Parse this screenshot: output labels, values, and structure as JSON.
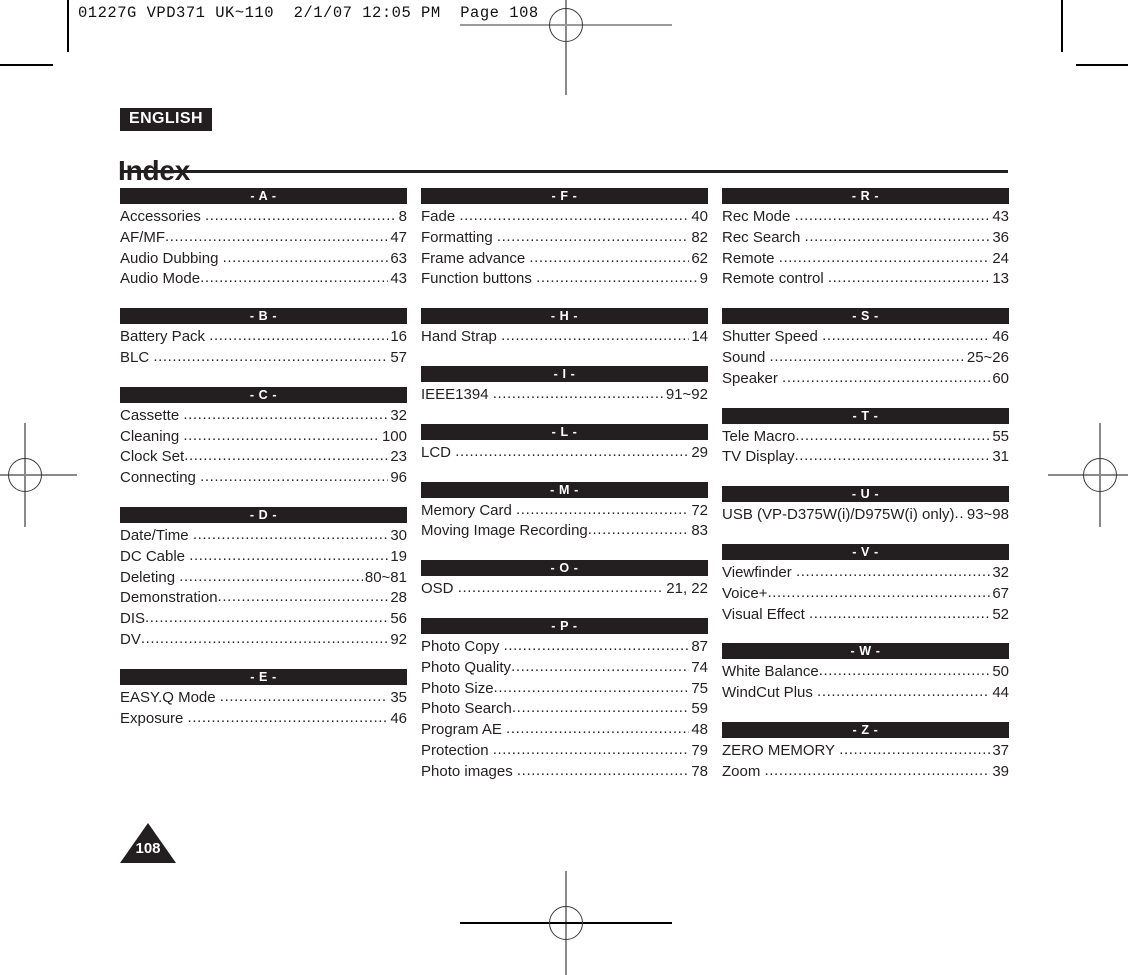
{
  "print_slug": "01227G VPD371 UK~110  2/1/07 12:05 PM  Page 108",
  "header": {
    "language_badge": "ENGLISH",
    "title": "Index"
  },
  "page_number": "108",
  "colors": {
    "ink": "#231f20",
    "paper": "#ffffff",
    "bar_text": "#ffffff",
    "reg_mark": "#8a8a8a"
  },
  "columns": [
    {
      "name": "column-left",
      "sections": [
        {
          "letter": "- A -",
          "entries": [
            {
              "label": "Accessories",
              "page": "8",
              "gap": true
            },
            {
              "label": "AF/MF",
              "page": "47",
              "gap": false
            },
            {
              "label": "Audio Dubbing",
              "page": "63",
              "gap": true
            },
            {
              "label": "Audio Mode",
              "page": "43",
              "gap": false
            }
          ]
        },
        {
          "letter": "- B -",
          "entries": [
            {
              "label": "Battery Pack",
              "page": "16",
              "gap": true
            },
            {
              "label": "BLC",
              "page": "57",
              "gap": true
            }
          ]
        },
        {
          "letter": "- C -",
          "entries": [
            {
              "label": "Cassette",
              "page": "32",
              "gap": true
            },
            {
              "label": "Cleaning",
              "page": "100",
              "gap": true
            },
            {
              "label": "Clock Set",
              "page": "23",
              "gap": false
            },
            {
              "label": "Connecting",
              "page": "96",
              "gap": true
            }
          ]
        },
        {
          "letter": "- D -",
          "entries": [
            {
              "label": "Date/Time",
              "page": "30",
              "gap": true
            },
            {
              "label": "DC Cable",
              "page": "19",
              "gap": true
            },
            {
              "label": "Deleting",
              "page": "80~81",
              "gap": true
            },
            {
              "label": "Demonstration",
              "page": "28",
              "gap": false
            },
            {
              "label": "DIS",
              "page": "56",
              "gap": false
            },
            {
              "label": "DV",
              "page": "92",
              "gap": false
            }
          ]
        },
        {
          "letter": "- E -",
          "entries": [
            {
              "label": "EASY.Q Mode",
              "page": "35",
              "gap": true
            },
            {
              "label": "Exposure",
              "page": "46",
              "gap": true
            }
          ]
        }
      ]
    },
    {
      "name": "column-middle",
      "sections": [
        {
          "letter": "- F -",
          "entries": [
            {
              "label": "Fade",
              "page": "40",
              "gap": true
            },
            {
              "label": "Formatting",
              "page": "82",
              "gap": true
            },
            {
              "label": "Frame advance",
              "page": "62",
              "gap": true
            },
            {
              "label": "Function buttons",
              "page": "9",
              "gap": true
            }
          ]
        },
        {
          "letter": "- H -",
          "entries": [
            {
              "label": "Hand Strap",
              "page": "14",
              "gap": true
            }
          ]
        },
        {
          "letter": "- I -",
          "entries": [
            {
              "label": "IEEE1394",
              "page": "91~92",
              "gap": true
            }
          ]
        },
        {
          "letter": "- L -",
          "entries": [
            {
              "label": "LCD",
              "page": "29",
              "gap": true
            }
          ]
        },
        {
          "letter": "- M -",
          "entries": [
            {
              "label": "Memory Card",
              "page": "72",
              "gap": true
            },
            {
              "label": "Moving Image Recording",
              "page": "83",
              "gap": false
            }
          ]
        },
        {
          "letter": "- O -",
          "entries": [
            {
              "label": "OSD",
              "page": "21, 22",
              "gap": true
            }
          ]
        },
        {
          "letter": "- P -",
          "entries": [
            {
              "label": "Photo Copy",
              "page": "87",
              "gap": true
            },
            {
              "label": "Photo Quality",
              "page": "74",
              "gap": false
            },
            {
              "label": "Photo Size",
              "page": "75",
              "gap": false
            },
            {
              "label": "Photo Search",
              "page": "59",
              "gap": false
            },
            {
              "label": "Program AE",
              "page": "48",
              "gap": true
            },
            {
              "label": "Protection",
              "page": "79",
              "gap": true
            },
            {
              "label": "Photo images",
              "page": "78",
              "gap": true
            }
          ]
        }
      ]
    },
    {
      "name": "column-right",
      "sections": [
        {
          "letter": "- R -",
          "entries": [
            {
              "label": "Rec Mode",
              "page": "43",
              "gap": true
            },
            {
              "label": "Rec Search",
              "page": "36",
              "gap": true
            },
            {
              "label": "Remote",
              "page": "24",
              "gap": true
            },
            {
              "label": "Remote control",
              "page": "13",
              "gap": true
            }
          ]
        },
        {
          "letter": "- S -",
          "entries": [
            {
              "label": "Shutter Speed",
              "page": "46",
              "gap": true
            },
            {
              "label": "Sound",
              "page": "25~26",
              "gap": true
            },
            {
              "label": "Speaker",
              "page": "60",
              "gap": true
            }
          ]
        },
        {
          "letter": "- T -",
          "entries": [
            {
              "label": "Tele Macro",
              "page": "55",
              "gap": false
            },
            {
              "label": "TV Display",
              "page": "31",
              "gap": false
            }
          ]
        },
        {
          "letter": "- U -",
          "entries": [
            {
              "label": "USB (VP-D375W(i)/D975W(i) only)",
              "page": "93~98",
              "gap": false
            }
          ]
        },
        {
          "letter": "- V -",
          "entries": [
            {
              "label": "Viewfinder",
              "page": "32",
              "gap": true
            },
            {
              "label": "Voice+",
              "page": "67",
              "gap": false
            },
            {
              "label": "Visual Effect",
              "page": "52",
              "gap": true
            }
          ]
        },
        {
          "letter": "- W -",
          "entries": [
            {
              "label": "White Balance",
              "page": "50",
              "gap": false
            },
            {
              "label": "WindCut Plus",
              "page": "44",
              "gap": true
            }
          ]
        },
        {
          "letter": "- Z -",
          "entries": [
            {
              "label": "ZERO MEMORY",
              "page": "37",
              "gap": true
            },
            {
              "label": "Zoom",
              "page": "39",
              "gap": true
            }
          ]
        }
      ]
    }
  ]
}
